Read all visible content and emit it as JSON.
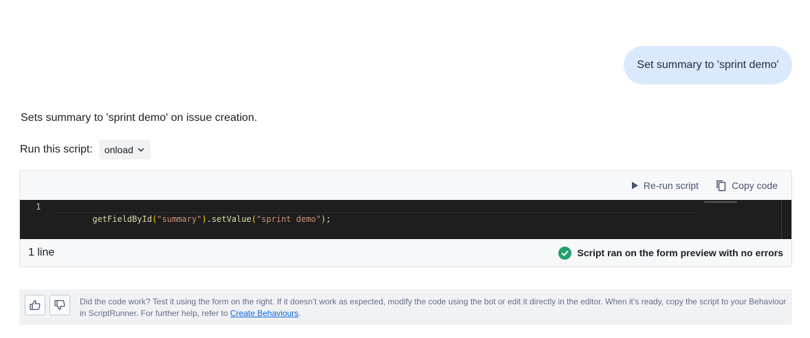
{
  "chat": {
    "user_message": "Set summary to 'sprint demo'",
    "assistant_description": "Sets summary to 'sprint demo' on issue creation."
  },
  "run_script": {
    "label": "Run this script:",
    "selected": "onload",
    "chevron_icon": "chevron-down-icon"
  },
  "code_panel": {
    "rerun_label": "Re-run script",
    "rerun_icon": "play-icon",
    "copy_label": "Copy code",
    "copy_icon": "copy-icon",
    "line_numbers": [
      "1"
    ],
    "code_tokens": [
      {
        "text": "getFieldById",
        "kind": "fn"
      },
      {
        "text": "(",
        "kind": "paren"
      },
      {
        "text": "\"summary\"",
        "kind": "str"
      },
      {
        "text": ")",
        "kind": "paren"
      },
      {
        "text": ".",
        "kind": "plain"
      },
      {
        "text": "setValue",
        "kind": "fn"
      },
      {
        "text": "(",
        "kind": "paren"
      },
      {
        "text": "\"sprint demo\"",
        "kind": "str"
      },
      {
        "text": ")",
        "kind": "paren"
      },
      {
        "text": ";",
        "kind": "plain"
      }
    ],
    "line_count": "1 line",
    "status_text": "Script ran on the form preview with no errors",
    "status_icon": "check-circle-icon",
    "status_color": "#22a06b"
  },
  "feedback": {
    "thumbs_up_icon": "thumbs-up-icon",
    "thumbs_down_icon": "thumbs-down-icon",
    "text_before": "Did the code work? Test it using the form on the right. If it doesn’t work as expected, modify the code using the bot or edit it directly in the editor. When it’s ready, copy the script to your Behaviour in ScriptRunner. For further help, refer to ",
    "link_text": "Create Behaviours",
    "text_after": "."
  }
}
